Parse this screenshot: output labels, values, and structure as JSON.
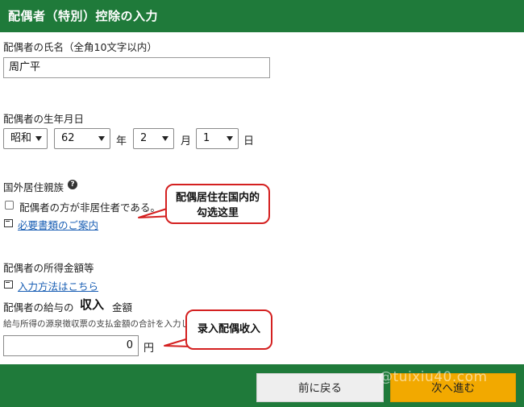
{
  "header": {
    "title": "配偶者（特別）控除の入力"
  },
  "name_section": {
    "label": "配偶者の氏名（全角10文字以内）",
    "value": "周广平"
  },
  "birth_section": {
    "label": "配偶者の生年月日",
    "era": "昭和",
    "year": "62",
    "year_unit": "年",
    "month": "2",
    "month_unit": "月",
    "day": "1",
    "day_unit": "日"
  },
  "overseas_section": {
    "label": "国外居住親族",
    "help_icon": "?",
    "checkbox_label": "配偶者の方が非居住者である。",
    "checked": false,
    "doc_link": "必要書類のご案内"
  },
  "income_section": {
    "label": "配偶者の所得金額等",
    "method_link": "入力方法はこちら",
    "salary_prefix": "配偶者の給与の",
    "salary_emphasis": "収入",
    "salary_suffix": "金額",
    "note": "給与所得の源泉徴収票の支払金額の合計を入力し",
    "amount": "0",
    "amount_unit": "円"
  },
  "footer": {
    "back_label": "前に戻る",
    "next_label": "次へ進む"
  },
  "annotations": {
    "callout1_line1": "配偶居住在国内的",
    "callout1_line2": "勾选这里",
    "callout2": "录入配偶收入"
  },
  "watermark": "@tuixiu40.com",
  "colors": {
    "header": "#1f7a3a",
    "next_button": "#f2a900",
    "callout_border": "#d42020",
    "link": "#1a5fb4"
  }
}
